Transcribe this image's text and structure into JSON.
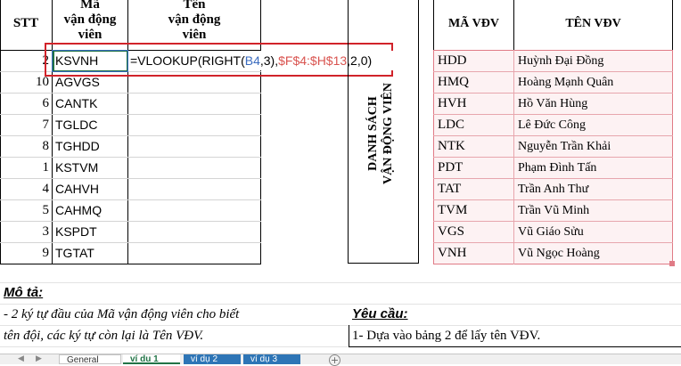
{
  "left_table": {
    "headers": {
      "stt": "STT",
      "ma": [
        "Mã",
        "vận động",
        "viên"
      ],
      "ten": [
        "Tên",
        "vận động",
        "viên"
      ]
    },
    "rows": [
      {
        "stt": "2",
        "ma": "KSVNH"
      },
      {
        "stt": "10",
        "ma": "AGVGS"
      },
      {
        "stt": "6",
        "ma": "CANTK"
      },
      {
        "stt": "7",
        "ma": "TGLDC"
      },
      {
        "stt": "8",
        "ma": "TGHDD"
      },
      {
        "stt": "1",
        "ma": "KSTVM"
      },
      {
        "stt": "4",
        "ma": "CAHVH"
      },
      {
        "stt": "5",
        "ma": "CAHMQ"
      },
      {
        "stt": "3",
        "ma": "KSPDT"
      },
      {
        "stt": "9",
        "ma": "TGTAT"
      }
    ]
  },
  "formula": {
    "prefix": "=VLOOKUP(RIGHT(",
    "ref1": "B4",
    "mid": ",3),",
    "ref2": "$F$4:$H$13",
    "suffix": ",2,0)"
  },
  "vertical_title": {
    "line1": "DANH SÁCH",
    "line2": "VẬN ĐỘNG VIÊN"
  },
  "right_table": {
    "headers": {
      "ma": "MÃ VĐV",
      "ten": "TÊN VĐV"
    },
    "rows": [
      {
        "ma": "HDD",
        "ten": "Huỳnh Đại Đồng"
      },
      {
        "ma": "HMQ",
        "ten": "Hoàng Mạnh Quân"
      },
      {
        "ma": "HVH",
        "ten": "Hồ Văn Hùng"
      },
      {
        "ma": "LDC",
        "ten": "Lê Đức Công"
      },
      {
        "ma": "NTK",
        "ten": "Nguyễn Trần Khải"
      },
      {
        "ma": "PDT",
        "ten": "Phạm Đình Tấn"
      },
      {
        "ma": "TAT",
        "ten": "Trần Anh Thư"
      },
      {
        "ma": "TVM",
        "ten": "Trần Vũ Minh"
      },
      {
        "ma": "VGS",
        "ten": "Vũ Giáo Sửu"
      },
      {
        "ma": "VNH",
        "ten": "Vũ Ngọc Hoàng"
      }
    ]
  },
  "mota": {
    "title": "Mô tả:",
    "line1": "- 2 ký tự đầu của Mã vận động viên cho biết",
    "line2": "tên đội, các ký tự còn lại là Tên VĐV."
  },
  "yeucau": {
    "title": "Yêu cầu:",
    "line1": "1- Dựa vào bảng 2 để lấy tên VĐV."
  },
  "tabs": [
    {
      "label": "General",
      "active": false
    },
    {
      "label": "ví dụ 1",
      "active": true
    },
    {
      "label": "ví dụ 2",
      "active": false
    },
    {
      "label": "ví dụ 3",
      "active": false
    }
  ],
  "add_sheet_icon": "plus-circle-icon",
  "colors": {
    "accent_red": "#d1232a",
    "ref_blue": "#3a6bbf",
    "ref_red": "#d9534f",
    "range_pink": "#e07b86",
    "tab_green": "#217346"
  }
}
